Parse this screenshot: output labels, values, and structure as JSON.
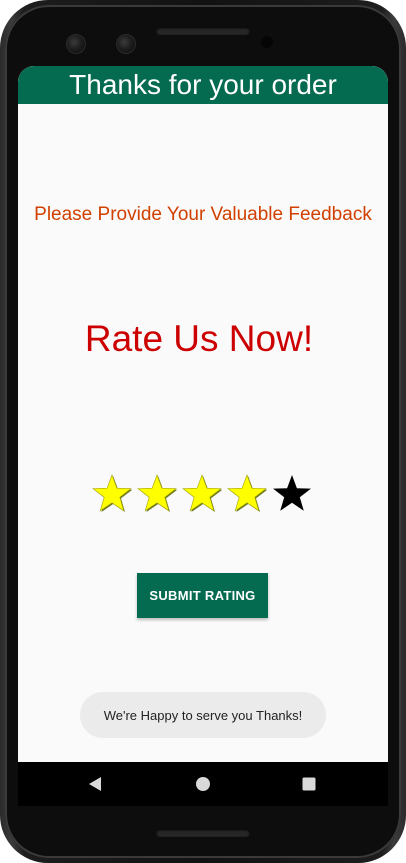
{
  "appbar": {
    "title": "Thanks for your order"
  },
  "content": {
    "feedback_prompt": "Please Provide Your Valuable Feedback",
    "rate_heading": "Rate Us Now!"
  },
  "rating": {
    "max_stars": 5,
    "value": 4,
    "filled_color": "#ffff00",
    "empty_color": "#000000"
  },
  "submit_button": {
    "label": "SUBMIT RATING"
  },
  "toast": {
    "message": "We're Happy to serve you Thanks!"
  },
  "colors": {
    "accent": "#046a50",
    "feedback_text": "#d14000",
    "heading_text": "#cc0000"
  },
  "navigation": {
    "buttons": [
      {
        "icon": "back-triangle-icon"
      },
      {
        "icon": "home-circle-icon"
      },
      {
        "icon": "recents-square-icon"
      }
    ]
  }
}
